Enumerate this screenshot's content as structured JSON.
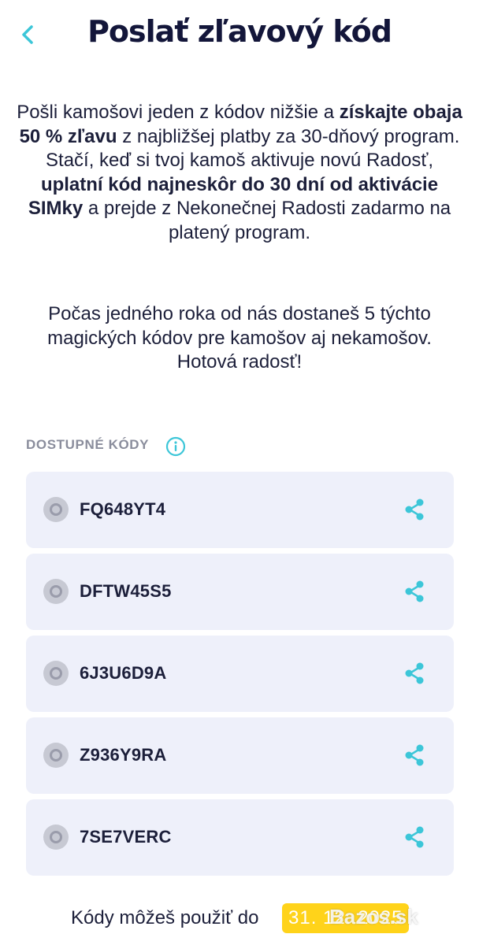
{
  "header": {
    "back_icon": "chevron-left-icon",
    "title": "Poslať zľavový kód"
  },
  "intro": {
    "p1_a": "Pošli kamošovi jeden z kódov nižšie a",
    "p1_bold1": "získajte obaja 50 % zľavu",
    "p1_b": " z najbližšej platby za 30-dňový program. Stačí, keď si tvoj kamoš aktivuje novú Radosť, ",
    "p1_bold2": "uplatní kód najneskôr do 30 dní od aktivácie SIMky",
    "p1_c": " a prejde z Nekonečnej Radosti zadarmo na platený program.",
    "p2": "Počas jedného roka od nás dostaneš 5 týchto magických kódov pre kamošov aj nekamošov. Hotová radosť!"
  },
  "section": {
    "label": "DOSTUPNÉ KÓDY",
    "info_icon": "info-icon"
  },
  "codes": [
    {
      "code": "FQ648YT4"
    },
    {
      "code": "DFTW45S5"
    },
    {
      "code": "6J3U6D9A"
    },
    {
      "code": "Z936Y9RA"
    },
    {
      "code": "7SE7VERC"
    }
  ],
  "footer": {
    "text": "Kódy môžeš použiť do",
    "date": "31. 12. 2025",
    "watermark": "Bazos.sk"
  },
  "colors": {
    "accent": "#3cc6d8",
    "card_bg": "#eef0fa",
    "date_badge": "#ffd31a",
    "title": "#13163a"
  }
}
